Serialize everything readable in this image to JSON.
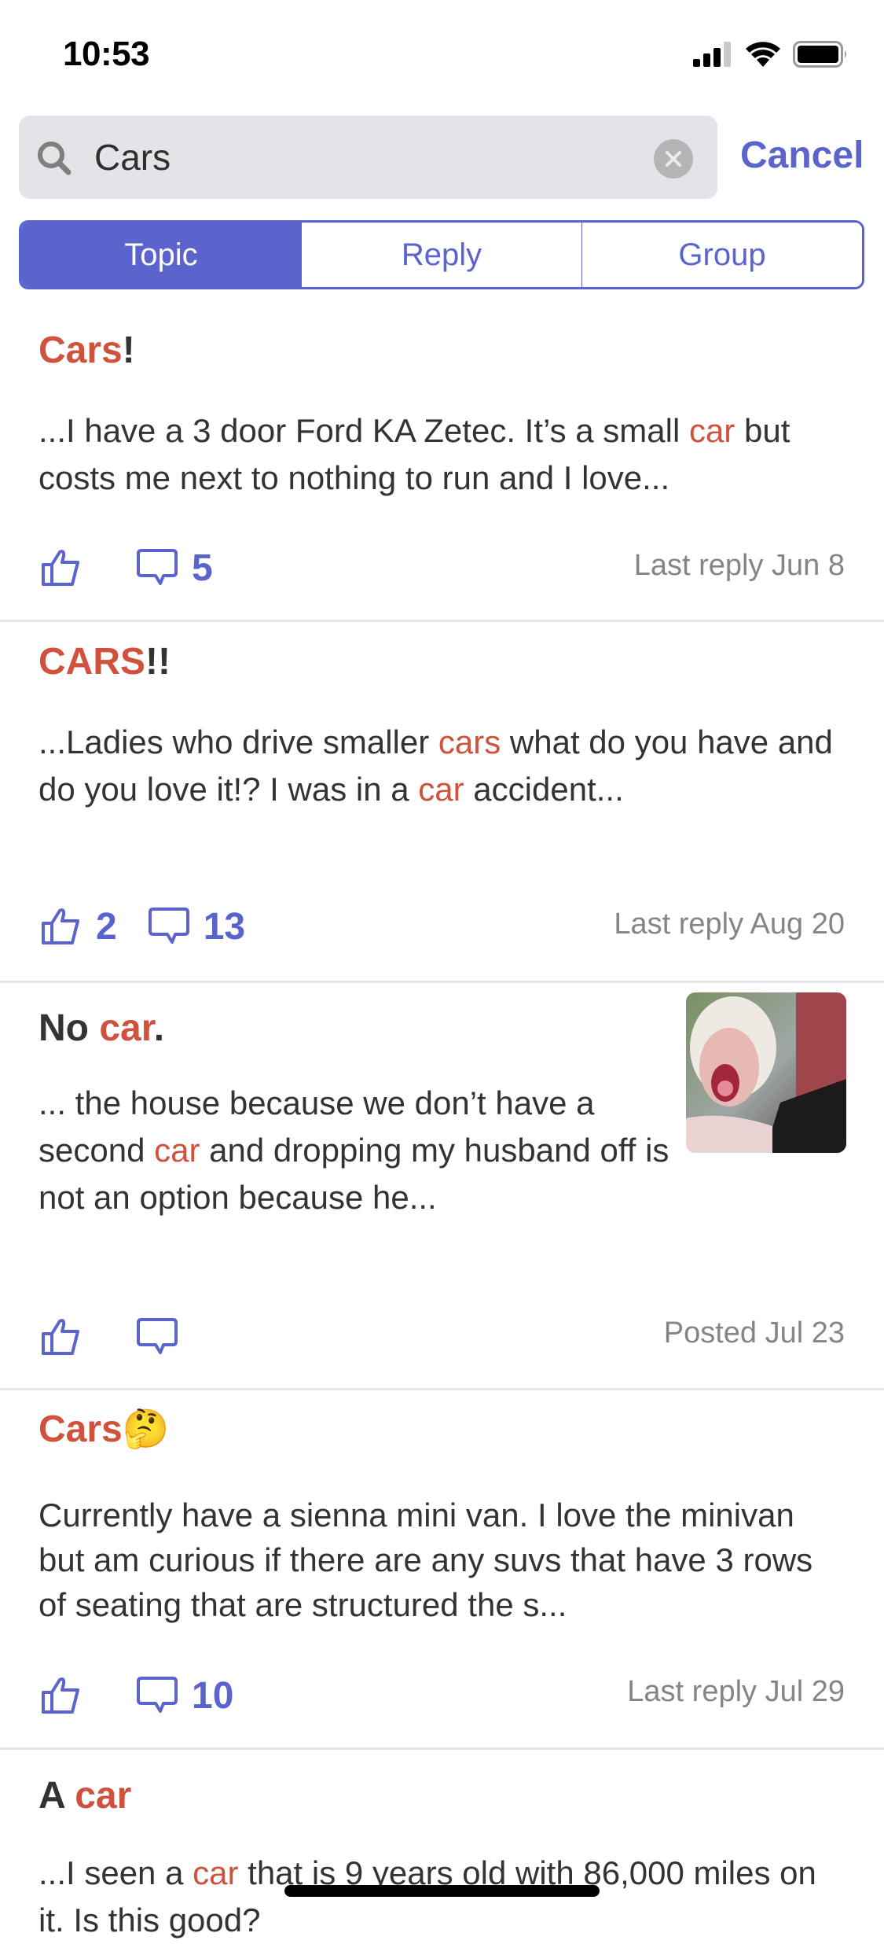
{
  "status_bar": {
    "time": "10:53",
    "signal_bars_filled": 3,
    "signal_bars_total": 4,
    "wifi": "wifi-icon",
    "battery": "battery-full-icon"
  },
  "search": {
    "query": "Cars",
    "placeholder": "Search",
    "search_icon": "search-icon",
    "clear_icon": "clear-icon",
    "cancel_label": "Cancel"
  },
  "segments": [
    {
      "label": "Topic",
      "active": true
    },
    {
      "label": "Reply",
      "active": false
    },
    {
      "label": "Group",
      "active": false
    }
  ],
  "colors": {
    "accent": "#5B63CC",
    "highlight": "#D0523D",
    "text": "#333333",
    "meta": "#858585",
    "search_bg": "#E3E4E8"
  },
  "posts": [
    {
      "title_parts": [
        {
          "t": "Cars",
          "hl": true
        },
        {
          "t": "!",
          "hl": false
        }
      ],
      "body_parts": [
        {
          "t": "...I have a 3 door Ford KA Zetec. It’s a small ",
          "hl": false
        },
        {
          "t": "car",
          "hl": true
        },
        {
          "t": " but costs me next to nothing to run and I love...",
          "hl": false
        }
      ],
      "likes": "",
      "comments": "5",
      "meta": "Last reply Jun 8",
      "has_thumbnail": false
    },
    {
      "title_parts": [
        {
          "t": "CARS",
          "hl": true
        },
        {
          "t": "!!",
          "hl": false
        }
      ],
      "body_parts": [
        {
          "t": "...Ladies who drive smaller ",
          "hl": false
        },
        {
          "t": "cars",
          "hl": true
        },
        {
          "t": " what do you have and do you love it!?  I was in a ",
          "hl": false
        },
        {
          "t": "car",
          "hl": true
        },
        {
          "t": " accident...",
          "hl": false
        }
      ],
      "likes": "2",
      "comments": "13",
      "meta": "Last reply Aug 20",
      "has_thumbnail": false
    },
    {
      "title_parts": [
        {
          "t": "No ",
          "hl": false
        },
        {
          "t": "car",
          "hl": true
        },
        {
          "t": ".",
          "hl": false
        }
      ],
      "body_parts": [
        {
          "t": "... the house because we don’t have a second ",
          "hl": false
        },
        {
          "t": "car",
          "hl": true
        },
        {
          "t": " and dropping my husband off is not an option because he...",
          "hl": false
        }
      ],
      "likes": "",
      "comments": "",
      "meta": "Posted Jul 23",
      "has_thumbnail": true,
      "thumbnail_alt": "GIF of a screaming woman with white hair"
    },
    {
      "title_parts": [
        {
          "t": "Cars",
          "hl": true
        },
        {
          "t": "🤔",
          "hl": false
        }
      ],
      "body_parts": [
        {
          "t": "Currently have a sienna mini van. I love the minivan but am curious if there are any suvs that have 3 rows of seating that are structured the s...",
          "hl": false
        }
      ],
      "likes": "",
      "comments": "10",
      "meta": "Last reply Jul 29",
      "has_thumbnail": false
    },
    {
      "title_parts": [
        {
          "t": "A ",
          "hl": false
        },
        {
          "t": "car",
          "hl": true
        }
      ],
      "body_parts": [
        {
          "t": "...I seen a ",
          "hl": false
        },
        {
          "t": "car",
          "hl": true
        },
        {
          "t": " that is 9 years old with 86,000 miles on it. Is this good?",
          "hl": false
        }
      ],
      "likes": "",
      "comments": "",
      "meta": "",
      "has_thumbnail": false
    }
  ]
}
